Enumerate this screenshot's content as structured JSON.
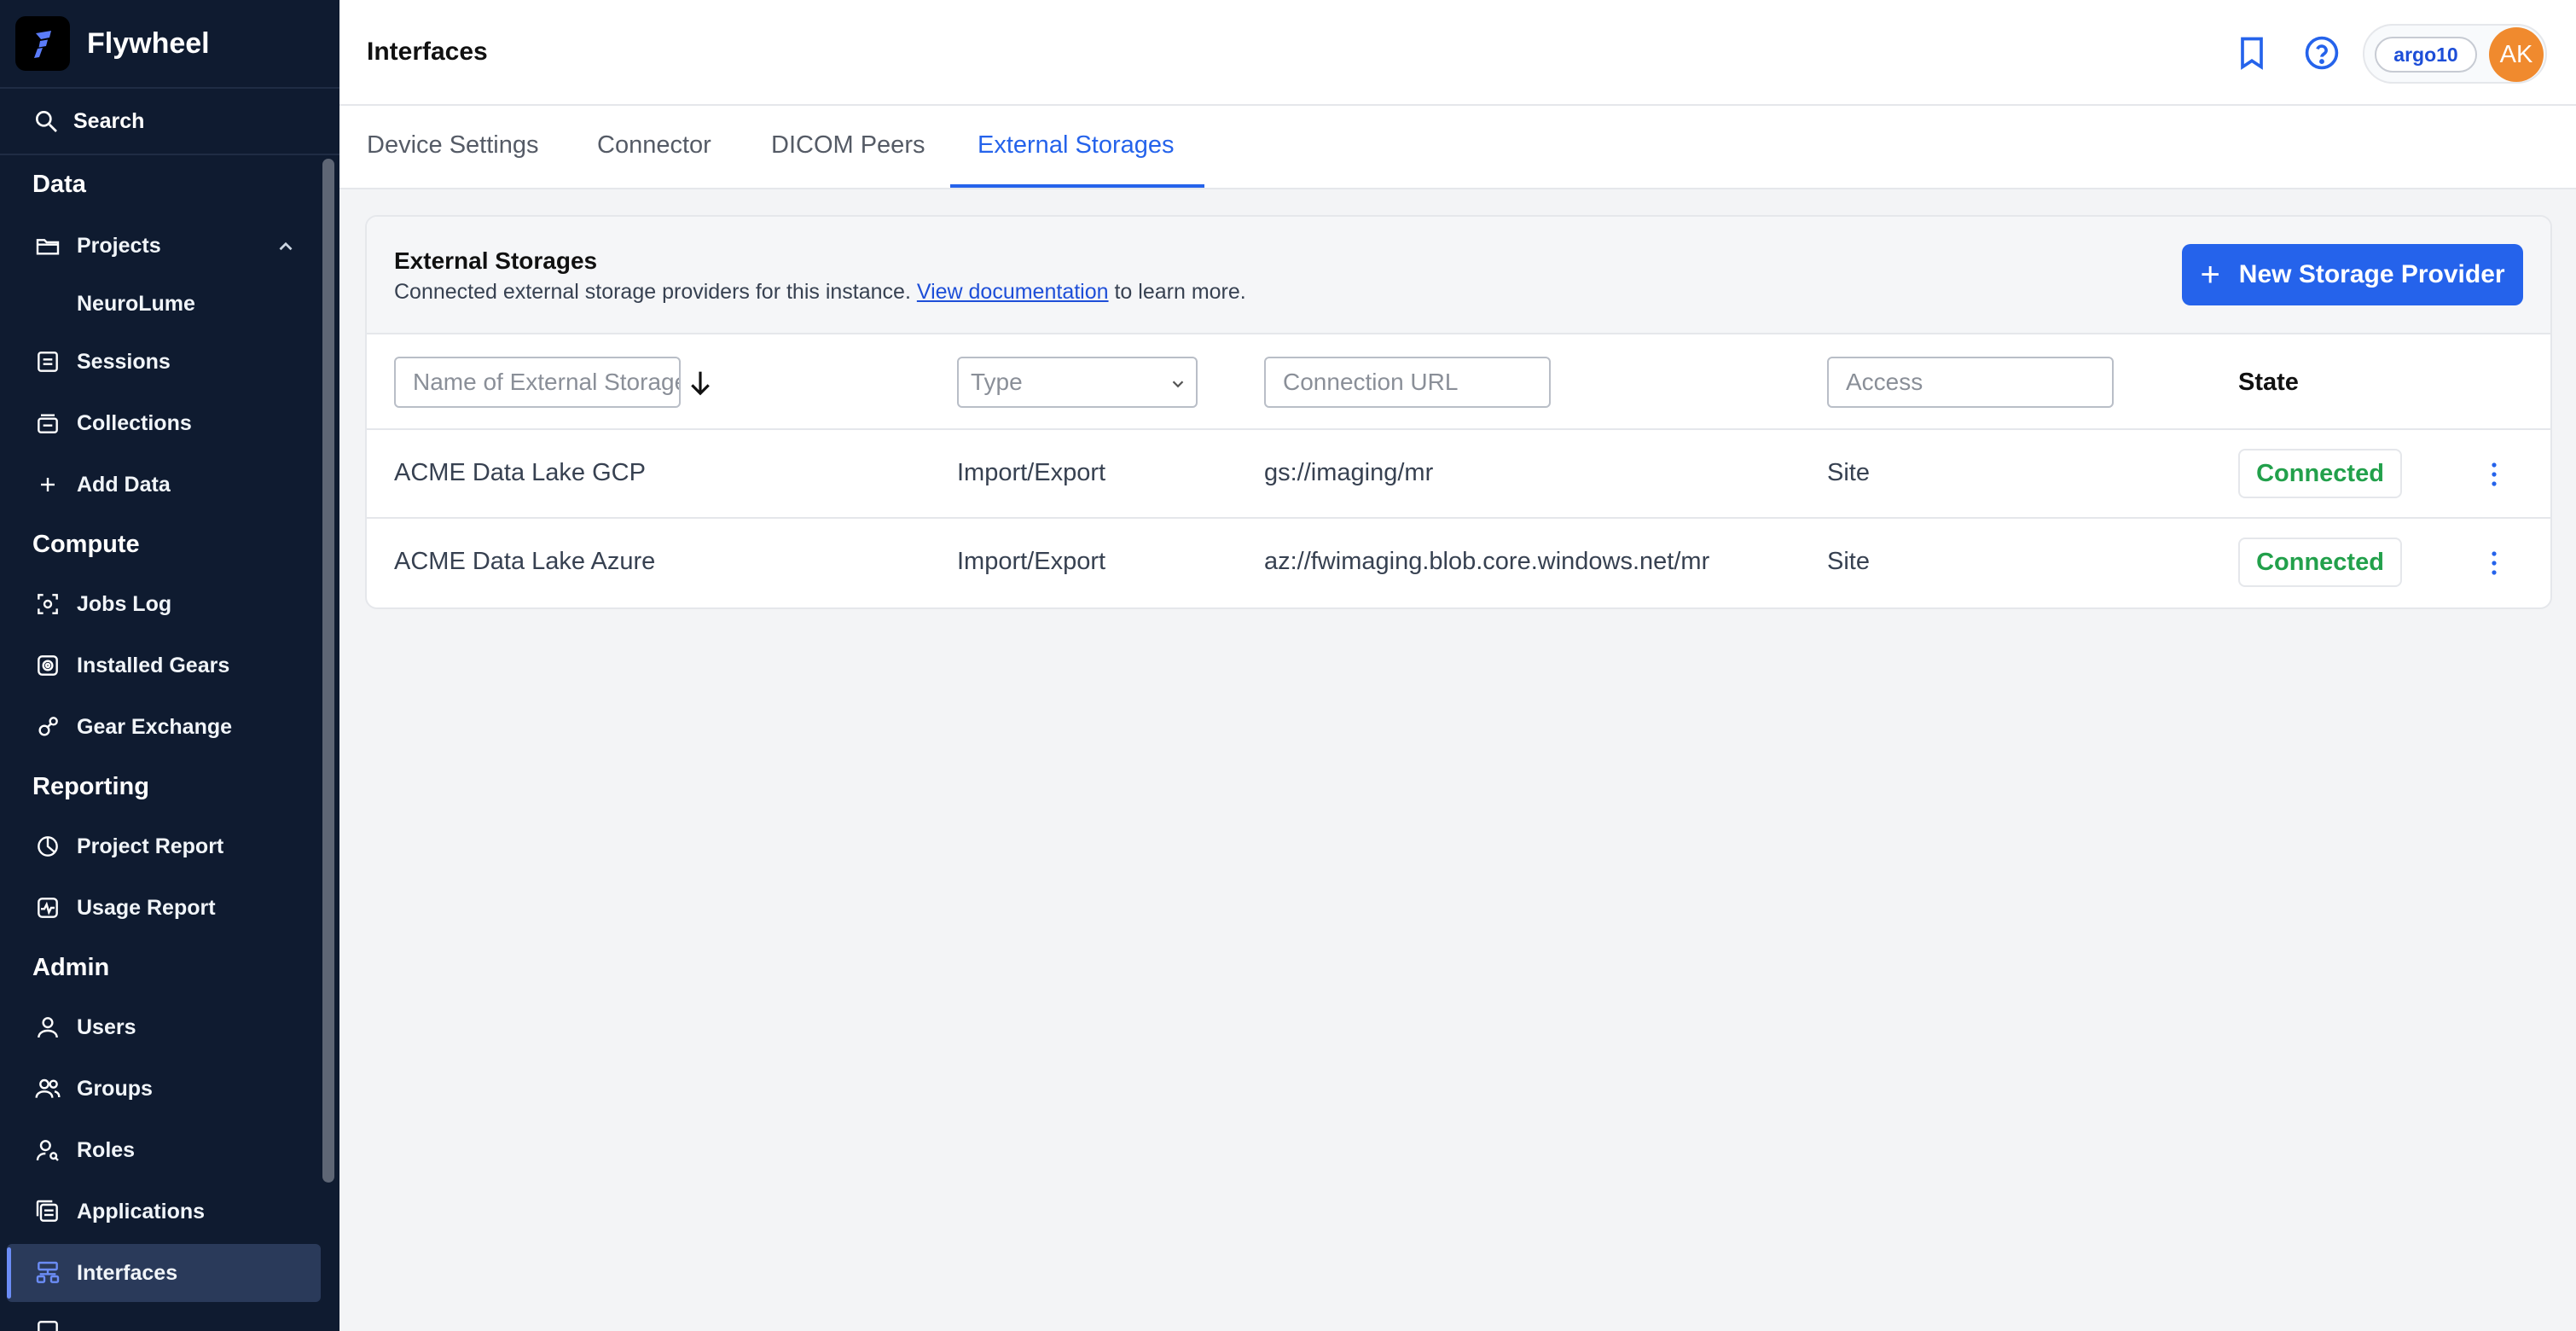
{
  "sidebar": {
    "brand": "Flywheel",
    "search": "Search",
    "sections": {
      "data": "Data",
      "compute": "Compute",
      "reporting": "Reporting",
      "admin": "Admin"
    },
    "items": {
      "projects": "Projects",
      "neurolume": "NeuroLume",
      "sessions": "Sessions",
      "collections": "Collections",
      "add_data": "Add Data",
      "jobs_log": "Jobs Log",
      "installed_gears": "Installed Gears",
      "gear_exchange": "Gear Exchange",
      "project_report": "Project Report",
      "usage_report": "Usage Report",
      "users": "Users",
      "groups": "Groups",
      "roles": "Roles",
      "applications": "Applications",
      "interfaces": "Interfaces"
    }
  },
  "header": {
    "title": "Interfaces",
    "org": "argo10",
    "avatar": "AK"
  },
  "tabs": [
    {
      "label": "Device Settings",
      "active": false
    },
    {
      "label": "Connector",
      "active": false
    },
    {
      "label": "DICOM Peers",
      "active": false
    },
    {
      "label": "External Storages",
      "active": true
    }
  ],
  "card": {
    "title": "External Storages",
    "desc_before": "Connected external storage providers for this instance.",
    "desc_link": "View documentation",
    "desc_after": "to learn more.",
    "new_button": "New Storage Provider"
  },
  "filters": {
    "name_placeholder": "Name of External Storage",
    "type_placeholder": "Type",
    "url_placeholder": "Connection URL",
    "access_placeholder": "Access",
    "state_header": "State"
  },
  "rows": [
    {
      "name": "ACME Data Lake GCP",
      "type": "Import/Export",
      "url": "gs://imaging/mr",
      "access": "Site",
      "state": "Connected"
    },
    {
      "name": "ACME Data Lake Azure",
      "type": "Import/Export",
      "url": "az://fwimaging.blob.core.windows.net/mr",
      "access": "Site",
      "state": "Connected"
    }
  ],
  "colors": {
    "sidebar_bg": "#0f1b30",
    "accent": "#2563eb",
    "connected": "#22a04b",
    "avatar": "#f08a2e"
  }
}
